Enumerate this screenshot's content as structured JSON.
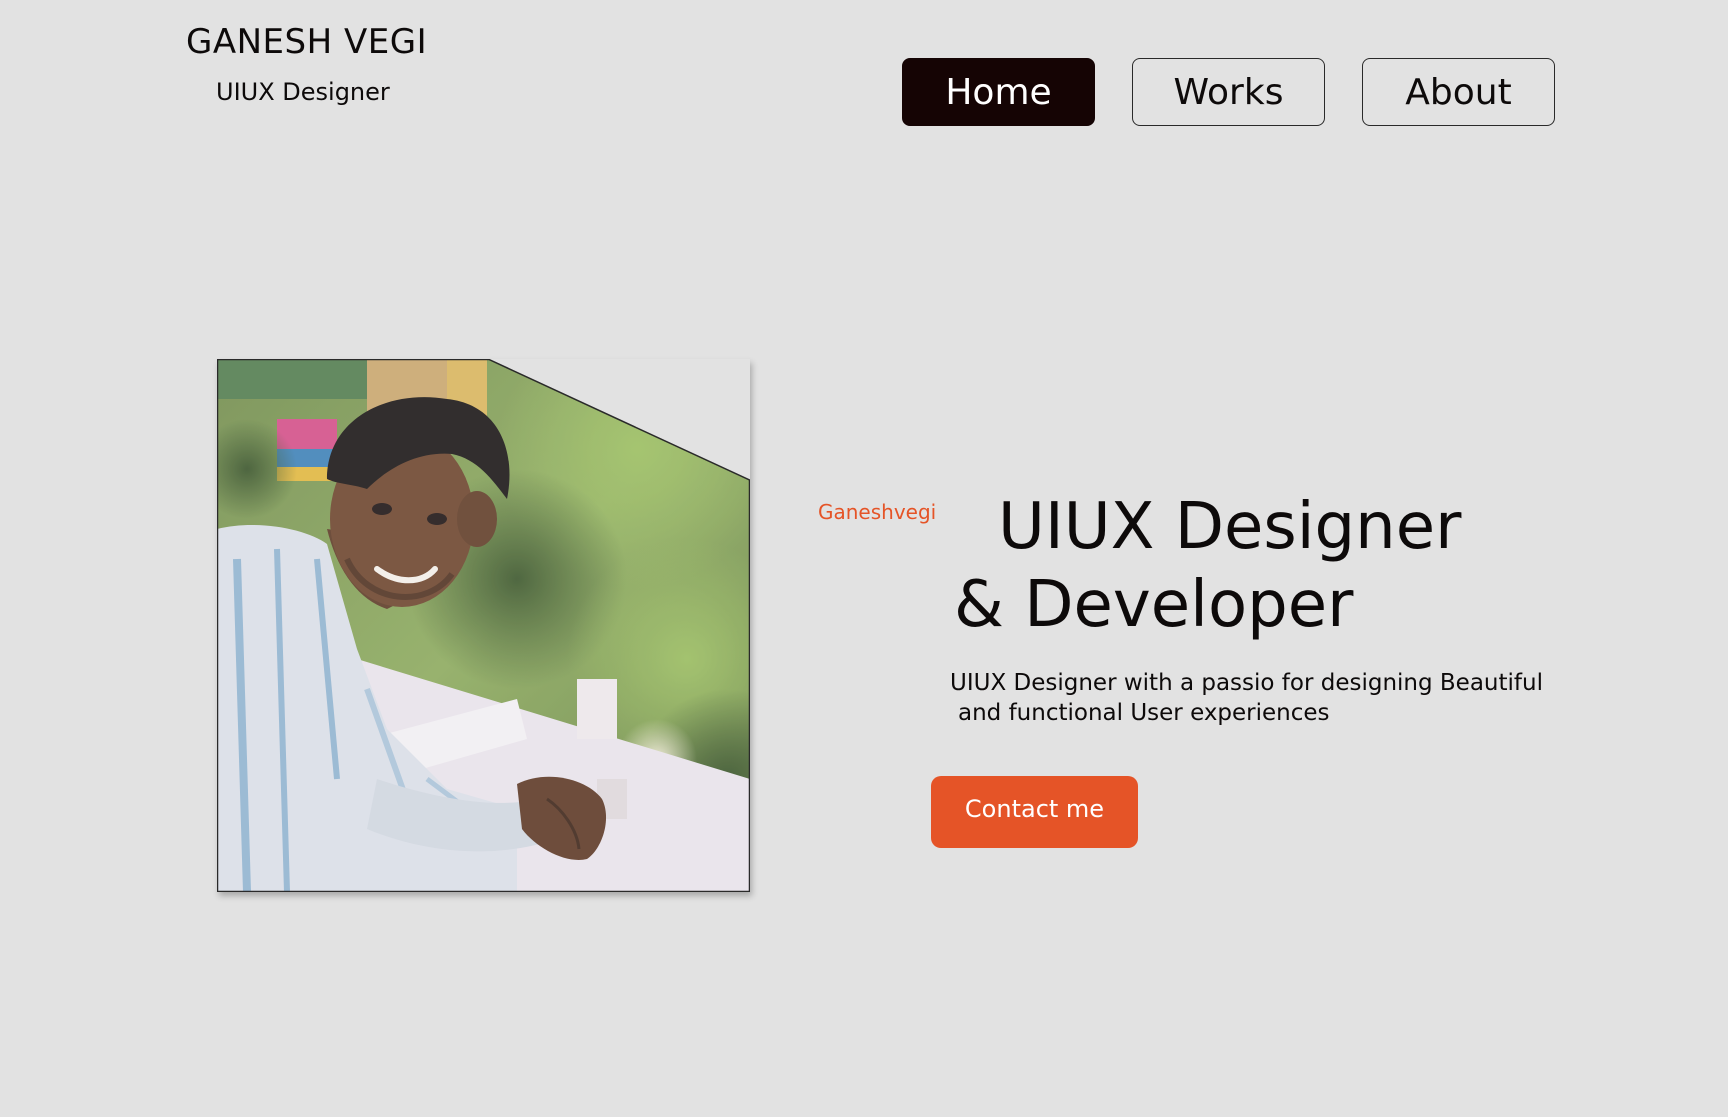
{
  "header": {
    "brand_name": "GANESH VEGI",
    "brand_role": "UIUX Designer"
  },
  "nav": {
    "items": [
      {
        "label": "Home",
        "active": true
      },
      {
        "label": "Works",
        "active": false
      },
      {
        "label": "About",
        "active": false
      }
    ]
  },
  "hero": {
    "handle": "Ganeshvegi",
    "headline_line1": "UIUX Designer",
    "headline_line2": "& Developer",
    "description_line1": "UIUX Designer with a passio for designing Beautiful",
    "description_line2": "and functional User experiences",
    "cta_label": "Contact me"
  },
  "colors": {
    "background": "#e2e2e2",
    "accent": "#e55427",
    "nav_active": "#150404",
    "text": "#0d0a0a"
  },
  "photo": {
    "subject": "portrait-photo"
  }
}
